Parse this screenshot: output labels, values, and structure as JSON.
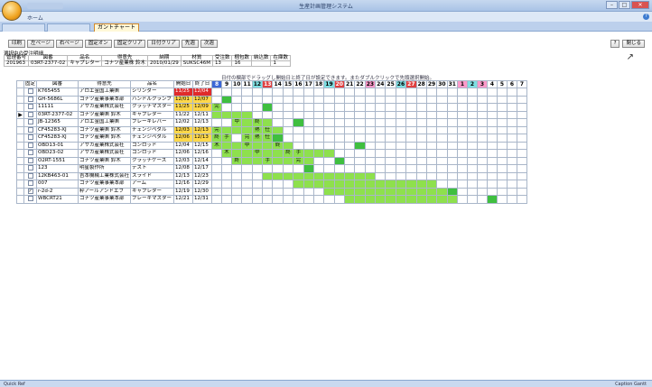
{
  "window": {
    "title": "生産計画管理システム",
    "min": "–",
    "max": "□",
    "close": "✕"
  },
  "menu": {
    "home_tab": "ホーム",
    "help": "?"
  },
  "doc_tabs": [
    "",
    "",
    "ガントチャート"
  ],
  "toolbar": [
    "印刷",
    "左ページ",
    "右ページ",
    "固定オン",
    "固定クリア",
    "日付クリア",
    "先週",
    "次週"
  ],
  "right_buttons": {
    "help": "?",
    "close": "閉じる"
  },
  "selection": {
    "label": "選択中の受注明細",
    "headers": [
      "管理番号",
      "図番",
      "品名",
      "得意先",
      "納期",
      "材質",
      "受注数",
      "梱包数",
      "納込数",
      "在庫数"
    ],
    "row": [
      "201963",
      "03RT-2377-02",
      "キャプレター",
      "コナツ産業株 鈴木",
      "2010/01/29",
      "SUKSC46M",
      "13",
      "16",
      "",
      "1"
    ]
  },
  "gantt_hint": "日付の欄部でドラッグし開始日と終了日が設定できます。またダブルクリックで先頭選択開始。",
  "columns": {
    "fixed": "固定",
    "drawing": "図番",
    "customer": "得意先",
    "name": "品名",
    "start": "開始日",
    "end": "終了日"
  },
  "days": [
    "8",
    "9",
    "10",
    "11",
    "12",
    "13",
    "14",
    "15",
    "16",
    "17",
    "18",
    "19",
    "20",
    "21",
    "22",
    "23",
    "24",
    "25",
    "26",
    "27",
    "28",
    "29",
    "30",
    "31",
    "1",
    "2",
    "3",
    "4",
    "5",
    "6",
    "7"
  ],
  "day_colors": [
    "blue",
    "",
    "",
    "",
    "cyan",
    "red",
    "",
    "",
    "",
    "",
    "",
    "cyan",
    "red",
    "",
    "",
    "pink",
    "",
    "",
    "cyan",
    "red",
    "",
    "",
    "",
    "",
    "pink",
    "cyan",
    "pink",
    "",
    "",
    "",
    ""
  ],
  "rows": [
    {
      "drawing": "K765455",
      "customer": "アロエ金国工業㈱",
      "name": "シリンダー",
      "start": "11/25",
      "end": "12/04",
      "start_style": "red",
      "end_style": "red",
      "arrow": "",
      "checked": false,
      "cells": {}
    },
    {
      "drawing": "GH-5686L",
      "customer": "コナツ産業事業本部",
      "name": "ハンドルクランプ",
      "start": "12/01",
      "end": "12/07",
      "start_style": "yellow",
      "end_style": "yellow",
      "arrow": "",
      "checked": false,
      "cells": {
        "1": "dark"
      }
    },
    {
      "drawing": "11111",
      "customer": "アサカ産業株式会社",
      "name": "クラッチマスター",
      "start": "11/25",
      "end": "12/09",
      "start_style": "yellow",
      "end_style": "yellow",
      "arrow": "",
      "checked": false,
      "cells": {
        "0": "green:完",
        "5": "dark"
      }
    },
    {
      "drawing": "03RT-2377-02",
      "customer": "コナツ産業㈱ 鈴木",
      "name": "キャプレター",
      "start": "11/22",
      "end": "12/11",
      "start_style": "",
      "end_style": "",
      "arrow": "▶",
      "checked": false,
      "cells": {
        "0": "green",
        "1": "green",
        "2": "green",
        "3": "green"
      }
    },
    {
      "drawing": "JB-12365",
      "customer": "アロエ金国工業㈱",
      "name": "ブレーキレバー",
      "start": "12/02",
      "end": "12/13",
      "start_style": "",
      "end_style": "",
      "arrow": "",
      "checked": false,
      "cells": {
        "2": "green:中",
        "3": "green",
        "4": "green:終",
        "5": "green",
        "8": "dark"
      }
    },
    {
      "drawing": "CF45283-XJ",
      "customer": "コナツ産業㈱ 鈴木",
      "name": "チェンジペダル",
      "start": "12/03",
      "end": "12/13",
      "start_style": "yellow",
      "end_style": "yellow",
      "arrow": "",
      "checked": false,
      "cells": {
        "0": "green:完",
        "1": "green",
        "2": "green",
        "3": "green",
        "4": "green:熱",
        "5": "green:仕",
        "6": "green"
      }
    },
    {
      "drawing": "CF45283-XJ",
      "customer": "コナツ産業㈱ 鈴木",
      "name": "チェンジペダル",
      "start": "12/06",
      "end": "12/13",
      "start_style": "yellow",
      "end_style": "yellow",
      "arrow": "",
      "checked": false,
      "cells": {
        "0": "green:終",
        "1": "green:手",
        "3": "green:完",
        "4": "green:熱",
        "5": "green:仕",
        "6": "dark"
      }
    },
    {
      "drawing": "OBD13-01",
      "customer": "アサカ産業株式会社",
      "name": "コンロッド",
      "start": "12/04",
      "end": "12/15",
      "start_style": "",
      "end_style": "",
      "arrow": "",
      "checked": false,
      "cells": {
        "0": "green:木",
        "1": "green",
        "2": "green",
        "3": "green:中",
        "4": "green",
        "5": "green",
        "6": "green:終",
        "7": "green",
        "14": "dark"
      }
    },
    {
      "drawing": "OBD23-02",
      "customer": "アサカ産業株式会社",
      "name": "コンロッド",
      "start": "12/06",
      "end": "12/16",
      "start_style": "",
      "end_style": "",
      "arrow": "",
      "checked": false,
      "cells": {
        "1": "green:木",
        "2": "green",
        "3": "green",
        "4": "green:中",
        "5": "green",
        "6": "green",
        "7": "green:終",
        "8": "green:手",
        "9": "green",
        "10": "green",
        "11": "green"
      }
    },
    {
      "drawing": "O2RT-1551",
      "customer": "コナツ産業㈱ 鈴木",
      "name": "クラッチケース",
      "start": "12/03",
      "end": "12/14",
      "start_style": "",
      "end_style": "",
      "arrow": "",
      "checked": false,
      "cells": {
        "2": "green:終",
        "3": "green",
        "4": "green",
        "5": "green:手",
        "6": "green",
        "7": "green",
        "8": "green:完",
        "9": "green",
        "12": "dark"
      }
    },
    {
      "drawing": "123",
      "customer": "明星製作所",
      "name": "テスト",
      "start": "12/08",
      "end": "12/17",
      "start_style": "",
      "end_style": "",
      "arrow": "",
      "checked": false,
      "cells": {
        "9": "dark"
      }
    },
    {
      "drawing": "12KB463-01",
      "customer": "吉本機械工業株式会社",
      "name": "スライド",
      "start": "12/13",
      "end": "12/23",
      "start_style": "",
      "end_style": "",
      "arrow": "",
      "checked": false,
      "cells": {
        "5": "green",
        "6": "green",
        "7": "green",
        "8": "green",
        "9": "green",
        "10": "green",
        "11": "green",
        "12": "green",
        "13": "green",
        "14": "green",
        "15": "green"
      }
    },
    {
      "drawing": "007",
      "customer": "コナツ産業事業本部",
      "name": "アーム",
      "start": "12/16",
      "end": "12/29",
      "start_style": "",
      "end_style": "",
      "arrow": "",
      "checked": false,
      "cells": {
        "8": "green",
        "9": "green",
        "10": "green",
        "11": "green",
        "12": "green",
        "13": "green",
        "14": "green",
        "15": "green",
        "16": "green",
        "17": "green",
        "18": "green",
        "19": "green",
        "20": "green",
        "21": "green"
      }
    },
    {
      "drawing": "r-2d-2",
      "customer": "粋アールアンドエフ",
      "name": "キャプレター",
      "start": "12/19",
      "end": "12/30",
      "start_style": "",
      "end_style": "",
      "arrow": "",
      "checked": true,
      "cells": {
        "11": "green",
        "12": "green",
        "13": "green",
        "14": "green",
        "15": "green",
        "16": "green",
        "17": "green",
        "18": "green",
        "19": "green",
        "20": "green",
        "21": "green",
        "22": "green",
        "23": "dark"
      }
    },
    {
      "drawing": "WBCRT21",
      "customer": "コナツ産業事業本部",
      "name": "ブレーキマスター",
      "start": "12/21",
      "end": "12/31",
      "start_style": "",
      "end_style": "",
      "arrow": "",
      "checked": false,
      "cells": {
        "13": "green",
        "14": "green",
        "15": "green",
        "16": "green",
        "17": "green",
        "18": "green",
        "19": "green",
        "20": "green",
        "21": "green",
        "22": "green",
        "23": "green",
        "27": "dark"
      }
    }
  ],
  "status": {
    "left": "Quick Ref",
    "right": "Caption  Gantt"
  }
}
